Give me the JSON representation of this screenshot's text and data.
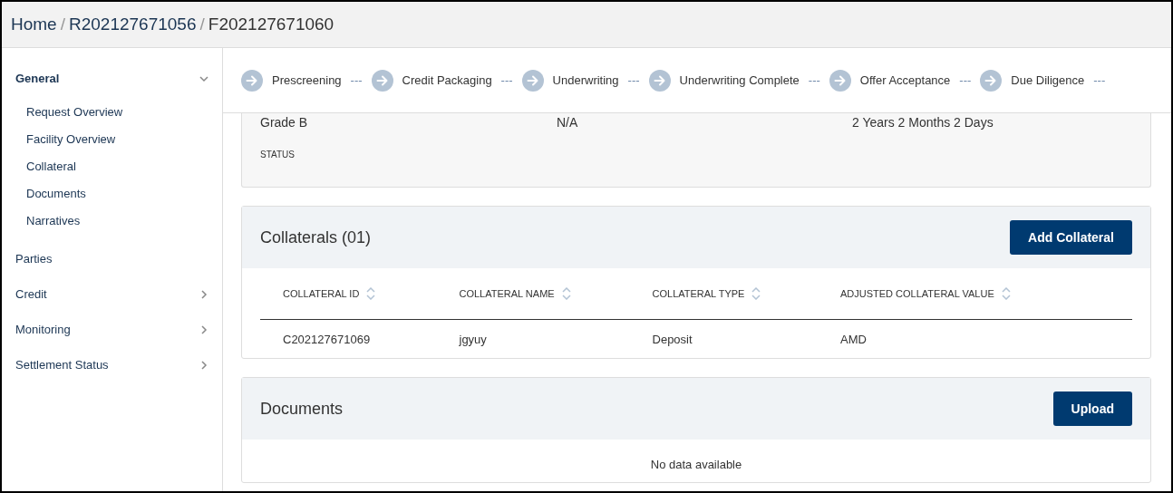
{
  "breadcrumb": [
    {
      "label": "Home",
      "separator": "/"
    },
    {
      "label": "R202127671056",
      "separator": "/"
    },
    {
      "label": "F202127671060"
    }
  ],
  "sidebar": {
    "items": [
      {
        "label": "General",
        "kind": "group",
        "expanded": true,
        "children": [
          {
            "label": "Request Overview"
          },
          {
            "label": "Facility Overview"
          },
          {
            "label": "Collateral"
          },
          {
            "label": "Documents"
          },
          {
            "label": "Narratives"
          }
        ]
      },
      {
        "label": "Parties",
        "kind": "link"
      },
      {
        "label": "Credit",
        "kind": "group",
        "expanded": false
      },
      {
        "label": "Monitoring",
        "kind": "group",
        "expanded": false
      },
      {
        "label": "Settlement Status",
        "kind": "group",
        "expanded": false
      }
    ]
  },
  "stepper": [
    {
      "label": "Prescreening",
      "separator": "---"
    },
    {
      "label": "Credit Packaging",
      "separator": "---"
    },
    {
      "label": "Underwriting",
      "separator": "---"
    },
    {
      "label": "Underwriting Complete",
      "separator": "---"
    },
    {
      "label": "Offer Acceptance",
      "separator": "---"
    },
    {
      "label": "Due Diligence",
      "separator": "---"
    }
  ],
  "summary_card": {
    "values": [
      "Grade B",
      "N/A",
      "2 Years 2 Months 2 Days"
    ],
    "status_label": "STATUS"
  },
  "collaterals": {
    "title": "Collaterals (01)",
    "button": "Add Collateral",
    "columns": [
      "COLLATERAL ID",
      "COLLATERAL NAME",
      "COLLATERAL TYPE",
      "ADJUSTED COLLATERAL VALUE"
    ],
    "rows": [
      [
        "C202127671069",
        "jgyuy",
        "Deposit",
        "AMD"
      ]
    ]
  },
  "documents": {
    "title": "Documents",
    "button": "Upload",
    "empty_text": "No data available"
  }
}
